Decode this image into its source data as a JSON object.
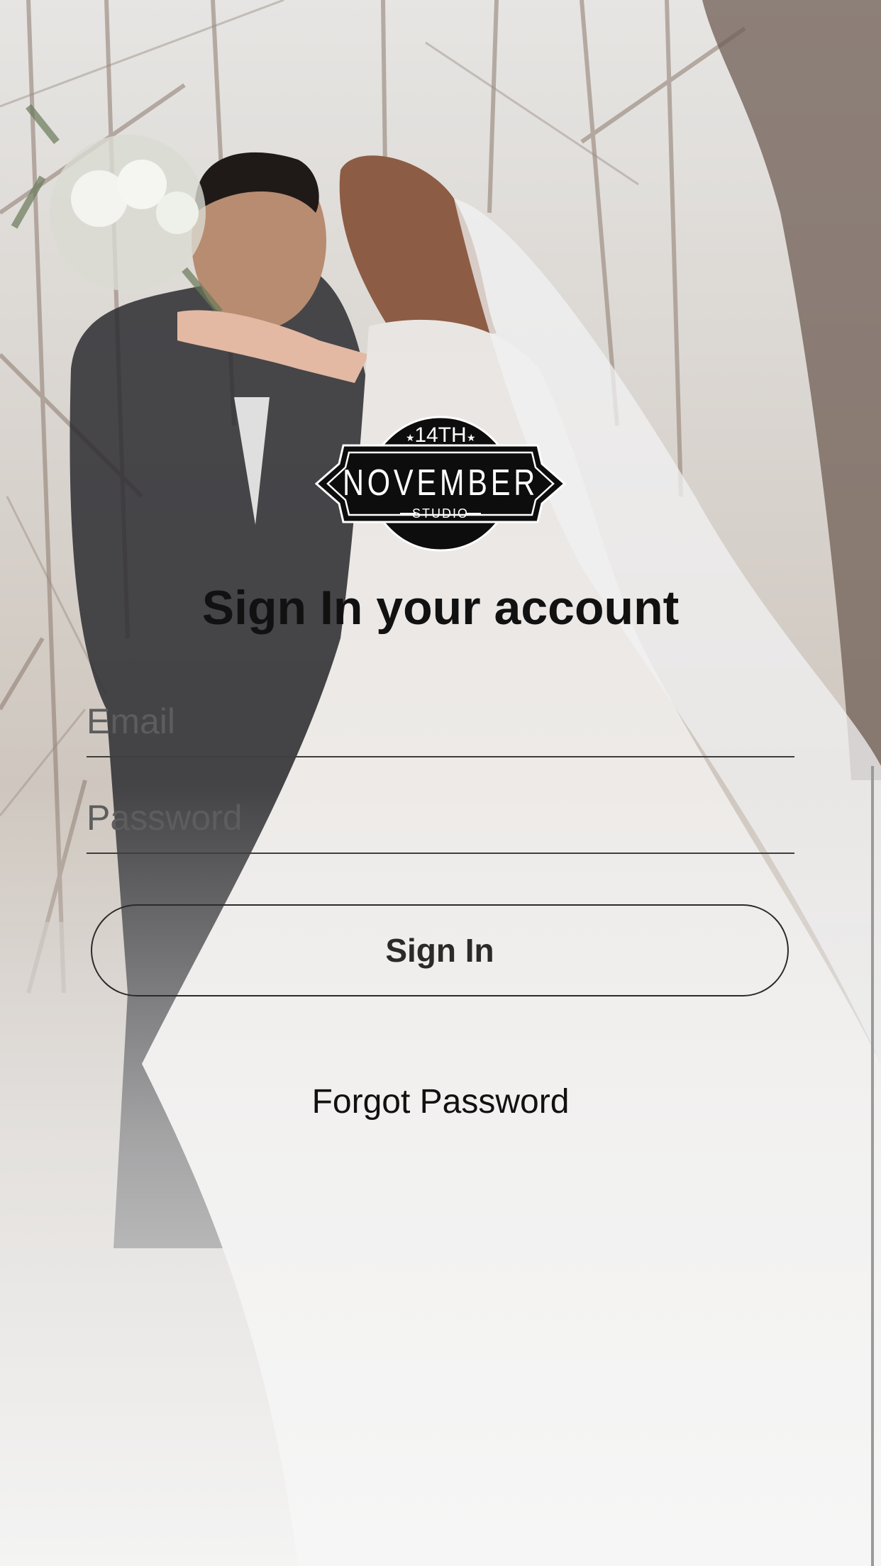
{
  "logo": {
    "top_text": "14TH",
    "main_text": "NOVEMBER",
    "sub_text": "STUDIO"
  },
  "signin": {
    "title": "Sign In your account",
    "email_placeholder": "Email",
    "password_placeholder": "Password",
    "button_label": "Sign In",
    "forgot_label": "Forgot Password"
  },
  "colors": {
    "text": "#111111",
    "underline": "#3e3e3e",
    "button_border": "#2b2b2b"
  }
}
